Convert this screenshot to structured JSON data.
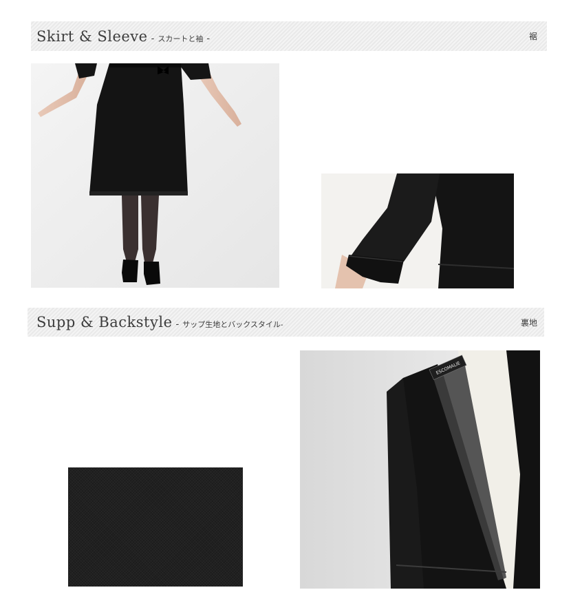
{
  "section1": {
    "title_en": "Skirt & Sleeve",
    "dash_open": "-",
    "title_jp": "スカートと袖",
    "dash_close": "-",
    "right_label": "裾"
  },
  "section2": {
    "title_en": "Supp & Backstyle",
    "dash_open": "-",
    "title_jp": "サップ生地とバックスタイル-",
    "right_label": "裏地"
  },
  "images": {
    "jacket_tag": "ESCOMALIE"
  }
}
